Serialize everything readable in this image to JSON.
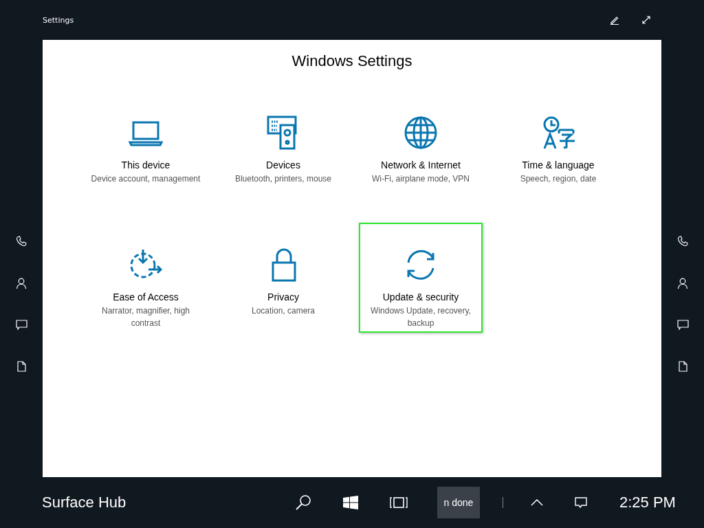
{
  "window": {
    "title": "Settings"
  },
  "page_title": "Windows Settings",
  "tiles": [
    {
      "kind": "laptop",
      "title": "This device",
      "subtitle": "Device account, management",
      "selected": false
    },
    {
      "kind": "devices",
      "title": "Devices",
      "subtitle": "Bluetooth, printers, mouse",
      "selected": false
    },
    {
      "kind": "globe",
      "title": "Network & Internet",
      "subtitle": "Wi-Fi, airplane mode, VPN",
      "selected": false
    },
    {
      "kind": "language",
      "title": "Time & language",
      "subtitle": "Speech, region, date",
      "selected": false
    },
    {
      "kind": "ease",
      "title": "Ease of Access",
      "subtitle": "Narrator, magnifier, high contrast",
      "selected": false
    },
    {
      "kind": "lock",
      "title": "Privacy",
      "subtitle": "Location, camera",
      "selected": false
    },
    {
      "kind": "sync",
      "title": "Update & security",
      "subtitle": "Windows Update, recovery, backup",
      "selected": true
    }
  ],
  "taskbar": {
    "brand": "Surface Hub",
    "active_app": "n done",
    "clock": "2:25 PM"
  }
}
